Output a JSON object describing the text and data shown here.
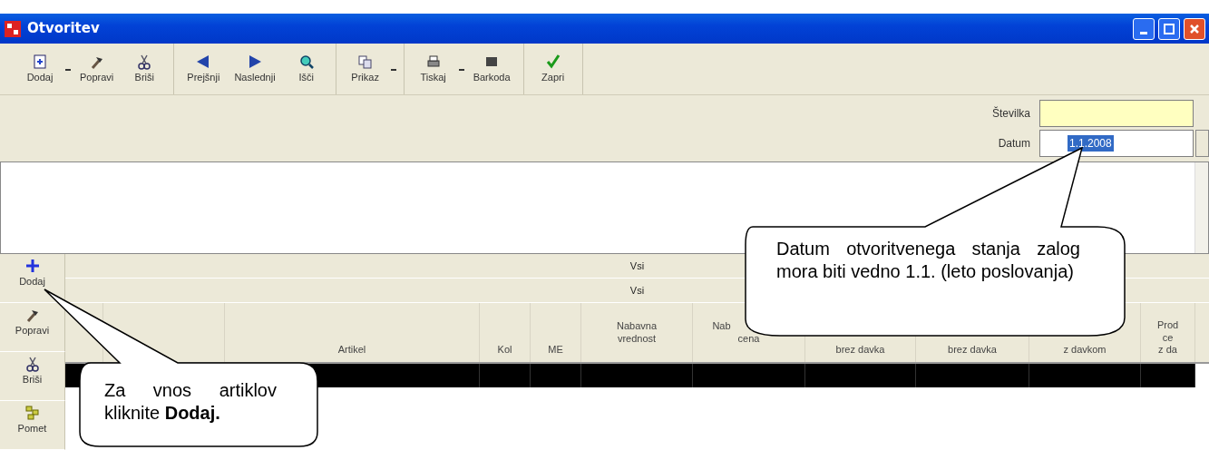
{
  "window": {
    "title": "Otvoritev"
  },
  "toolbar": {
    "groups": [
      [
        {
          "label": "Dodaj",
          "dropdown": true
        },
        {
          "label": "Popravi",
          "dropdown": false
        },
        {
          "label": "Briši",
          "dropdown": false
        }
      ],
      [
        {
          "label": "Prejšnji",
          "dropdown": false
        },
        {
          "label": "Naslednji",
          "dropdown": false
        },
        {
          "label": "Išči",
          "dropdown": false
        }
      ],
      [
        {
          "label": "Prikaz",
          "dropdown": true
        }
      ],
      [
        {
          "label": "Tiskaj",
          "dropdown": true
        },
        {
          "label": "Barkoda",
          "dropdown": false
        }
      ],
      [
        {
          "label": "Zapri",
          "dropdown": false
        }
      ]
    ]
  },
  "form": {
    "fields": [
      {
        "label": "Številka",
        "highlighted": true
      },
      {
        "label": "Datum",
        "value": "1.1.2008",
        "highlighted": false,
        "value_selected": true
      }
    ]
  },
  "side_toolbar": {
    "buttons": [
      {
        "label": "Dodaj"
      },
      {
        "label": "Popravi"
      },
      {
        "label": "Briši"
      },
      {
        "label": "Pomet"
      }
    ]
  },
  "table": {
    "group_rows": [
      "Vsi",
      "Vsi"
    ],
    "columns": [
      {
        "lines": [
          "Artikel"
        ]
      },
      {
        "lines": [
          "Kol"
        ]
      },
      {
        "lines": [
          "ME"
        ]
      },
      {
        "lines": [
          "Nabavna",
          "vrednost"
        ]
      },
      {
        "lines": [
          "Nab",
          "cena"
        ]
      },
      {
        "lines": [
          "brez davka"
        ]
      },
      {
        "lines": [
          "brez davka"
        ]
      },
      {
        "lines": [
          "z davkom"
        ]
      },
      {
        "lines": [
          "Prod",
          "ce",
          "z da"
        ]
      }
    ],
    "rows": [
      {
        "selected": true
      }
    ]
  },
  "callouts": [
    {
      "text": "Datum otvoritvenega stanja zalog mora biti vedno 1.1. (leto poslovanja)"
    },
    {
      "text": "Za vnos artiklov kliknite **Dodaj.**"
    }
  ]
}
